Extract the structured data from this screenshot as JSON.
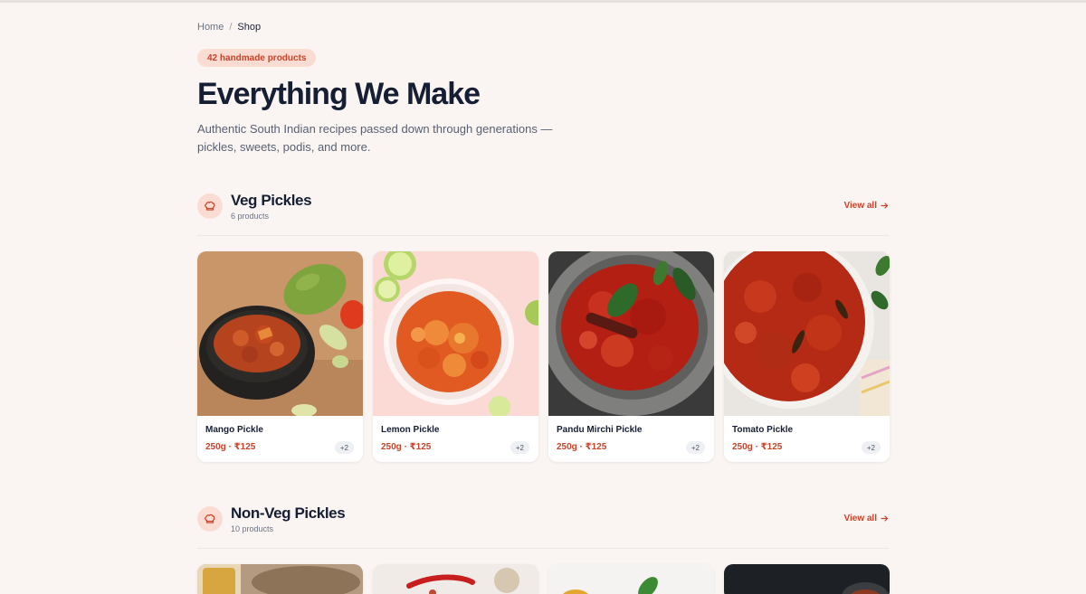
{
  "breadcrumb": {
    "home": "Home",
    "separator": "/",
    "current": "Shop"
  },
  "hero": {
    "count_badge": "42 handmade products",
    "title": "Everything We Make",
    "description": "Authentic South Indian recipes passed down through generations — pickles, sweets, podis, and more."
  },
  "sections": [
    {
      "title": "Veg Pickles",
      "count": "6 products",
      "view_all": "View all",
      "icon": "chef-hat-icon",
      "products": [
        {
          "name": "Mango Pickle",
          "price": "250g · ₹125",
          "more": "+2"
        },
        {
          "name": "Lemon Pickle",
          "price": "250g · ₹125",
          "more": "+2"
        },
        {
          "name": "Pandu Mirchi Pickle",
          "price": "250g · ₹125",
          "more": "+2"
        },
        {
          "name": "Tomato Pickle",
          "price": "250g · ₹125",
          "more": "+2"
        }
      ]
    },
    {
      "title": "Non-Veg Pickles",
      "count": "10 products",
      "view_all": "View all",
      "icon": "chef-hat-icon"
    }
  ],
  "colors": {
    "accent": "#c8432a",
    "accent_soft": "#fbdcd3",
    "background": "#faf5f2",
    "heading": "#161e33"
  }
}
